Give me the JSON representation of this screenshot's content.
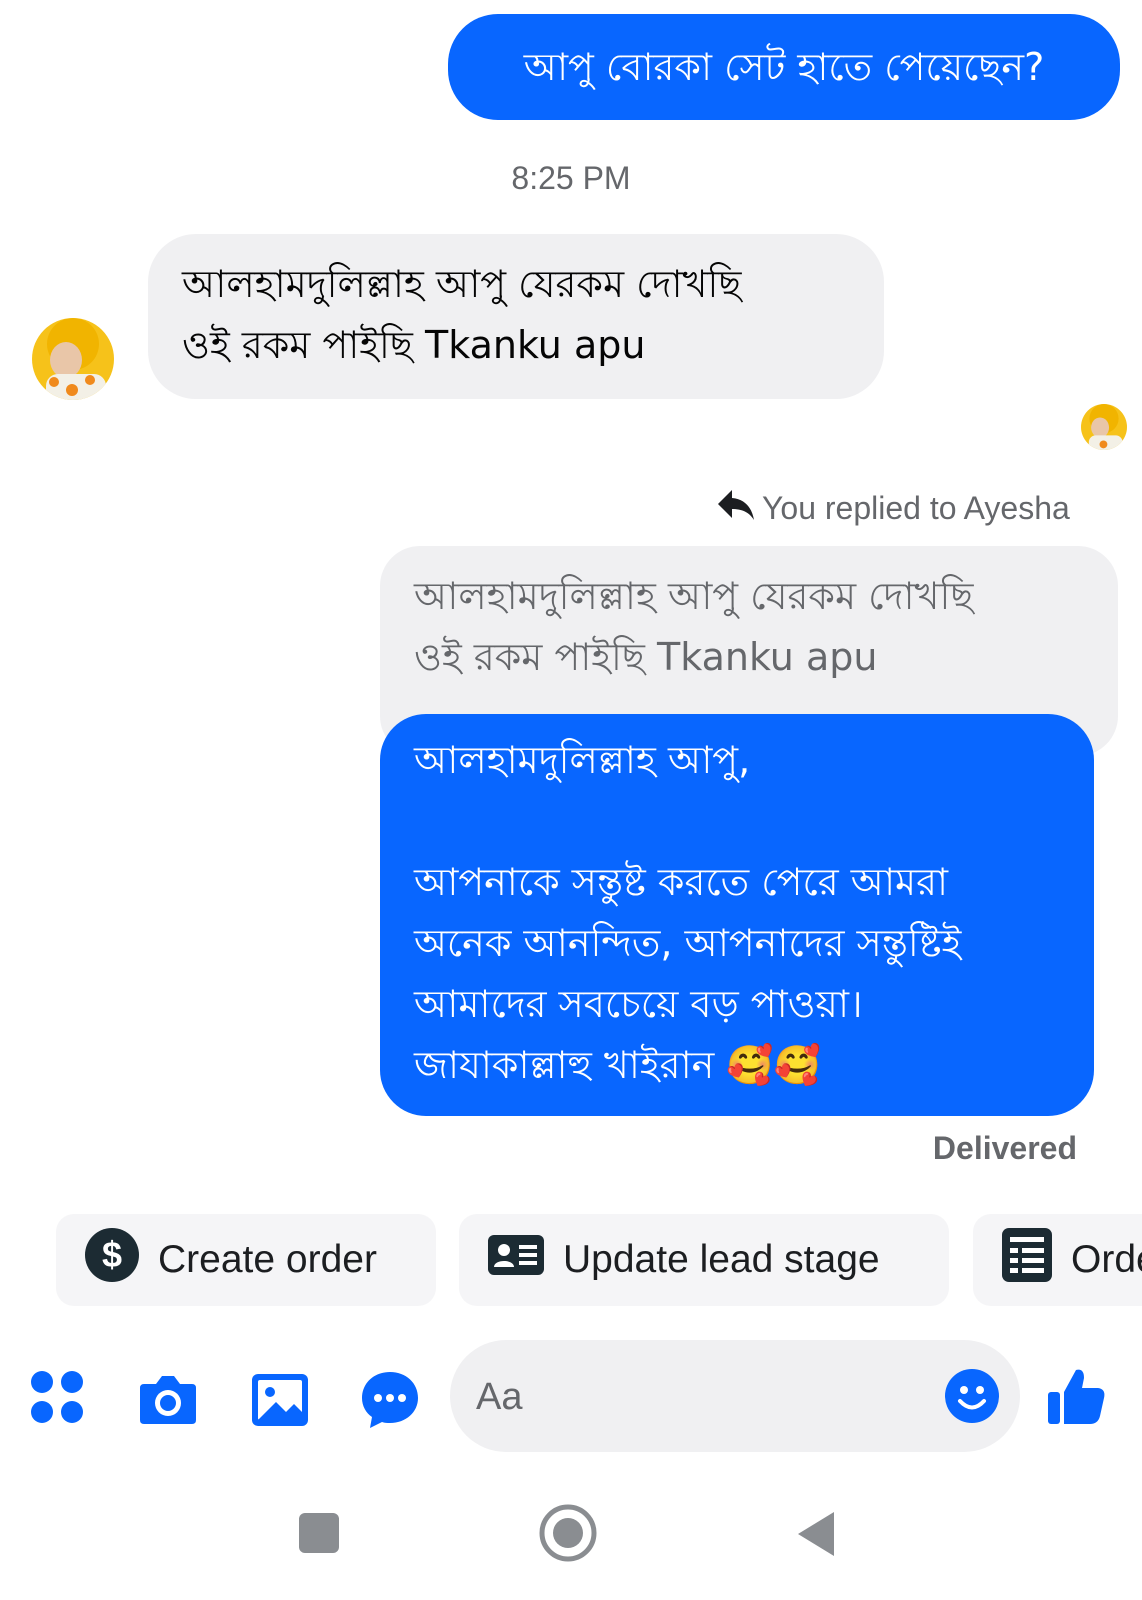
{
  "messages": {
    "msg1": "আপু বোরকা সেট হাতে পেয়েছেন?",
    "timestamp": "8:25 PM",
    "msg2": "আলহামদুলিল্লাহ আপু যেরকম দোখছি\nওই রকম পাইছি Tkanku  apu",
    "reply_header": "You replied to Ayesha",
    "quoted": "আলহামদুলিল্লাহ আপু যেরকম দোখছি\nওই রকম পাইছি Tkanku  apu",
    "msg3": "আলহামদুলিল্লাহ আপু,\n\nআপনাকে সন্তুষ্ট করতে পেরে আমরা\nঅনেক আনন্দিত, আপনাদের সন্তুষ্টিই\nআমাদের সবচেয়ে বড় পাওয়া।\nজাযাকাল্লাহু খাইরান 🥰🥰",
    "status": "Delivered"
  },
  "quick_actions": [
    {
      "label": "Create order",
      "icon": "dollar-icon"
    },
    {
      "label": "Update lead stage",
      "icon": "id-card-icon"
    },
    {
      "label": "Orders",
      "icon": "list-icon"
    }
  ],
  "composer": {
    "placeholder": "Aa",
    "icons": [
      "apps-icon",
      "camera-icon",
      "gallery-icon",
      "chat-bubble-icon",
      "emoji-icon",
      "like-icon"
    ]
  },
  "colors": {
    "accent": "#0866ff",
    "incoming_bubble": "#f0f0f2",
    "secondary_text": "#65676b"
  }
}
